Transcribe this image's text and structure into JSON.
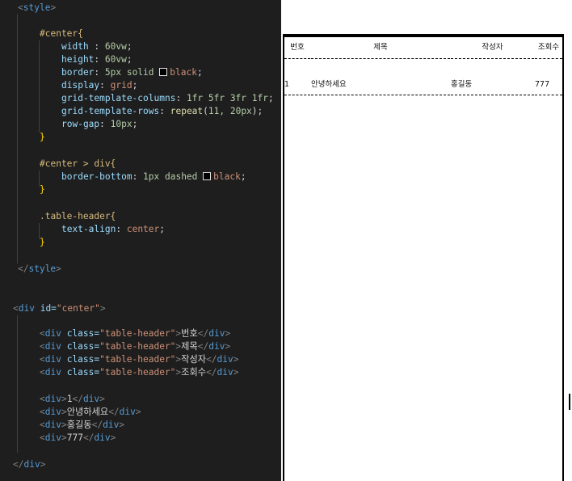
{
  "code": {
    "lines": [
      [
        "<",
        "style",
        ">"
      ],
      [
        "#center{"
      ],
      [
        "width",
        " : ",
        "60vw",
        ";"
      ],
      [
        "height",
        ": ",
        "60vw",
        ";"
      ],
      [
        "border",
        ": ",
        "5px solid ",
        "black",
        ";"
      ],
      [
        "display",
        ": ",
        "grid",
        ";"
      ],
      [
        "grid-template-columns",
        ": ",
        "1fr 5fr 3fr 1fr",
        ";"
      ],
      [
        "grid-template-rows",
        ": ",
        "repeat",
        "(",
        "11, 20px",
        ");"
      ],
      [
        "row-gap",
        ": ",
        "10px",
        ";"
      ],
      [
        "}"
      ],
      [
        "#center > div{"
      ],
      [
        "border-bottom",
        ": ",
        "1px dashed ",
        "black",
        ";"
      ],
      [
        "}"
      ],
      [
        ".table-header{"
      ],
      [
        "text-align",
        ": ",
        "center",
        ";"
      ],
      [
        "}"
      ],
      [
        "</",
        "style",
        ">"
      ],
      [
        "<",
        "div",
        " id=",
        "\"center\"",
        ">"
      ],
      [
        "<",
        "div",
        " class=",
        "\"table-header\"",
        ">",
        "번호",
        "</",
        "div",
        ">"
      ],
      [
        "<",
        "div",
        " class=",
        "\"table-header\"",
        ">",
        "제목",
        "</",
        "div",
        ">"
      ],
      [
        "<",
        "div",
        " class=",
        "\"table-header\"",
        ">",
        "작성자",
        "</",
        "div",
        ">"
      ],
      [
        "<",
        "div",
        " class=",
        "\"table-header\"",
        ">",
        "조회수",
        "</",
        "div",
        ">"
      ],
      [
        "<",
        "div",
        ">",
        "1",
        "</",
        "div",
        ">"
      ],
      [
        "<",
        "div",
        ">",
        "안녕하세요",
        "</",
        "div",
        ">"
      ],
      [
        "<",
        "div",
        ">",
        "홍길동",
        "</",
        "div",
        ">"
      ],
      [
        "<",
        "div",
        ">",
        "777",
        "</",
        "div",
        ">"
      ],
      [
        "</",
        "div",
        ">"
      ]
    ]
  },
  "preview": {
    "headers": [
      "번호",
      "제목",
      "작성자",
      "조회수"
    ],
    "row": [
      "1",
      "안녕하세요",
      "홍길동",
      "777"
    ]
  }
}
